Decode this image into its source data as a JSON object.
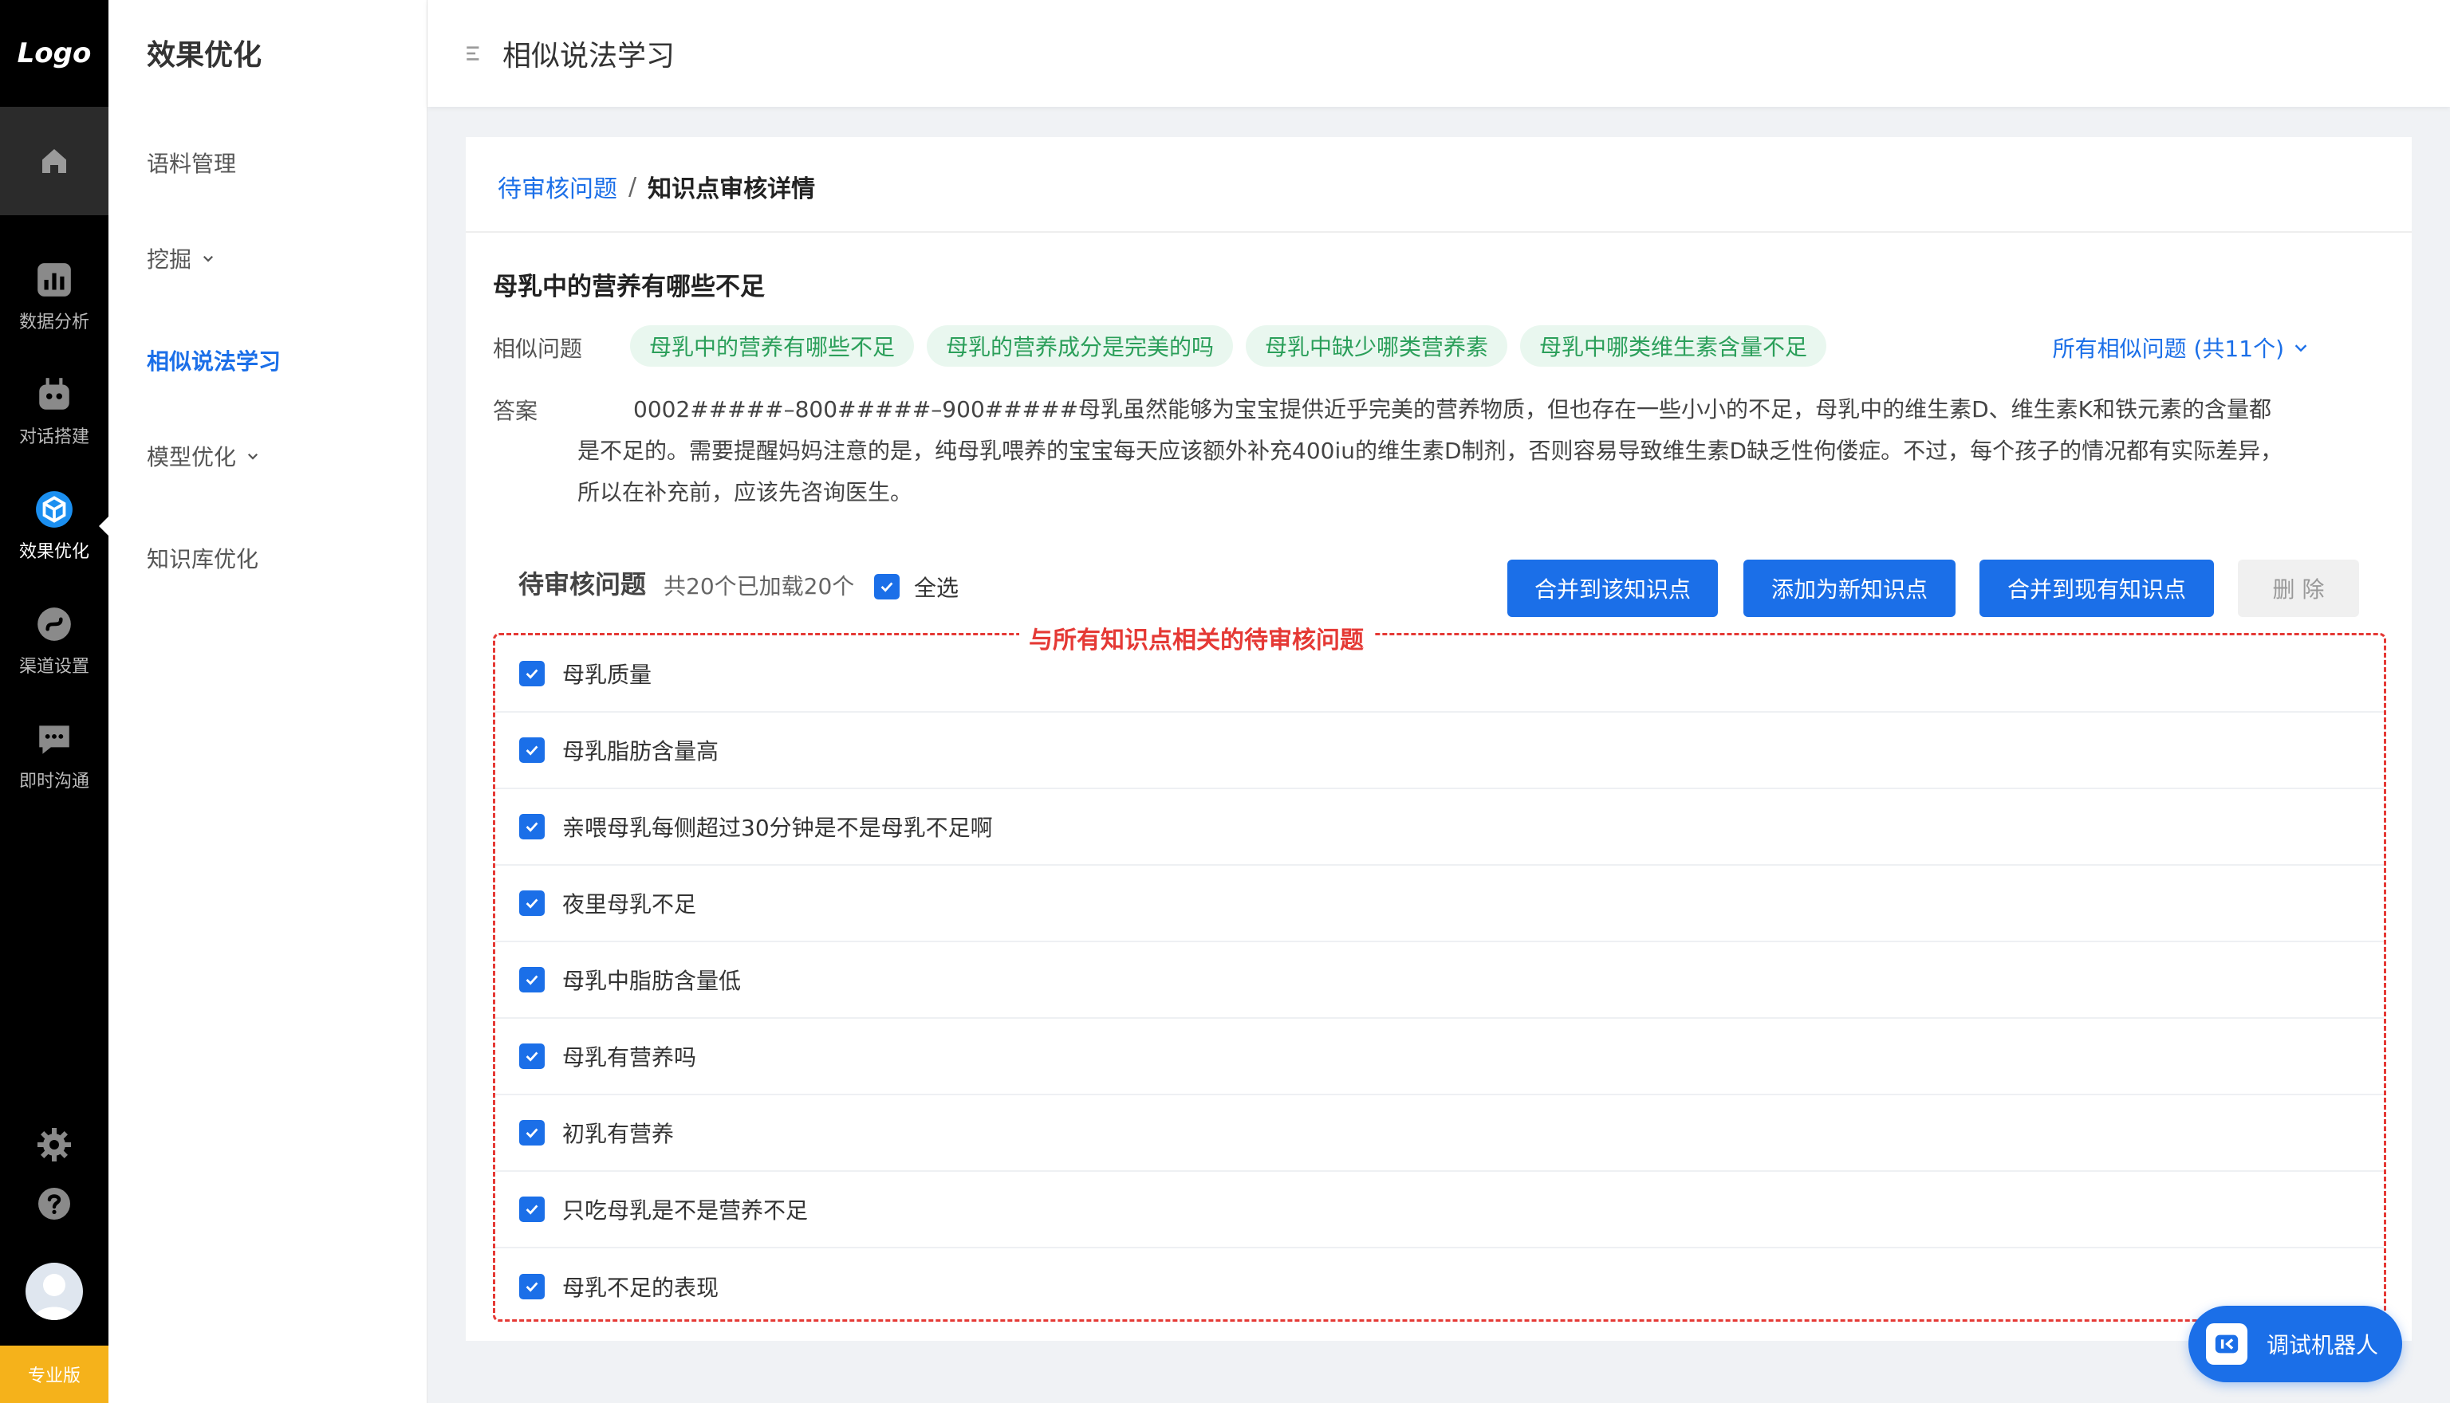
{
  "rail": {
    "logo": "Logo",
    "items": [
      {
        "label": "数据分析",
        "icon": "bar-chart-icon"
      },
      {
        "label": "对话搭建",
        "icon": "robot-icon"
      },
      {
        "label": "效果优化",
        "icon": "cube-icon"
      },
      {
        "label": "渠道设置",
        "icon": "channel-icon"
      },
      {
        "label": "即时沟通",
        "icon": "chat-icon"
      }
    ],
    "pro_badge": "专业版"
  },
  "sidebar": {
    "title": "效果优化",
    "items": [
      {
        "label": "语料管理"
      },
      {
        "label": "挖掘"
      },
      {
        "label": "相似说法学习"
      },
      {
        "label": "模型优化"
      },
      {
        "label": "知识库优化"
      }
    ]
  },
  "header": {
    "title": "相似说法学习"
  },
  "breadcrumb": {
    "link": "待审核问题",
    "separator": "/",
    "current": "知识点审核详情"
  },
  "question": {
    "title": "母乳中的营养有哪些不足",
    "similar_label": "相似问题",
    "tags": [
      "母乳中的营养有哪些不足",
      "母乳的营养成分是完美的吗",
      "母乳中缺少哪类营养素",
      "母乳中哪类维生素含量不足"
    ],
    "all_similar": "所有相似问题 (共11个)",
    "answer_label": "答案",
    "answer": "0002#####–800#####–900#####母乳虽然能够为宝宝提供近乎完美的营养物质，但也存在一些小小的不足，母乳中的维生素D、维生素K和铁元素的含量都是不足的。需要提醒妈妈注意的是，纯母乳喂养的宝宝每天应该额外补充400iu的维生素D制剂，否则容易导致维生素D缺乏性佝偻症。不过，每个孩子的情况都有实际差异，所以在补充前，应该先咨询医生。"
  },
  "pending": {
    "title": "待审核问题",
    "count": "共20个已加载20个",
    "select_all": "全选",
    "buttons": {
      "merge_this": "合并到该知识点",
      "add_new": "添加为新知识点",
      "merge_existing": "合并到现有知识点",
      "delete": "删 除"
    },
    "group_label": "与所有知识点相关的待审核问题",
    "items": [
      "母乳质量",
      "母乳脂肪含量高",
      "亲喂母乳每侧超过30分钟是不是母乳不足啊",
      "夜里母乳不足",
      "母乳中脂肪含量低",
      "母乳有营养吗",
      "初乳有营养",
      "只吃母乳是不是营养不足",
      "母乳不足的表现"
    ]
  },
  "robot": {
    "label": "调试机器人"
  },
  "colors": {
    "primary": "#1b6fe8",
    "tag_bg": "#e9f7ef",
    "tag_text": "#2b9f5a",
    "alert": "#e53935",
    "pro": "#f5b21b"
  }
}
